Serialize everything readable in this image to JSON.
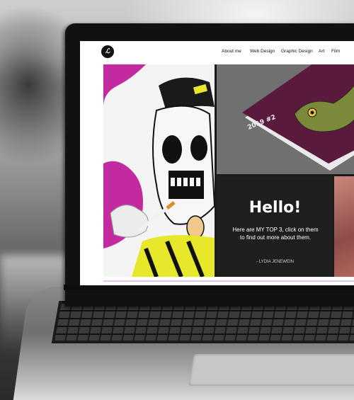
{
  "nav": {
    "logo_text": "ℒ",
    "items": [
      {
        "label": "About me"
      },
      {
        "label": "Web Design"
      },
      {
        "label": "Graphic Design"
      },
      {
        "label": "Art"
      },
      {
        "label": "Film"
      }
    ]
  },
  "tiles": {
    "skull_art": {
      "alt": "skull smoking illustration"
    },
    "magazine": {
      "cover_text": "2019 #2"
    },
    "hello": {
      "title": "Hello!",
      "body": "Here are MY TOP 3, click on them to find out more about them.",
      "signature": "- LYDIA JENEWEIN"
    },
    "flower": {
      "alt": "flower photo"
    }
  },
  "colors": {
    "accent_magenta": "#c42aa0",
    "tile_dark": "#1e1e1e",
    "magazine_purple": "#5a1a3e",
    "skull_yellow": "#e7e82a"
  }
}
